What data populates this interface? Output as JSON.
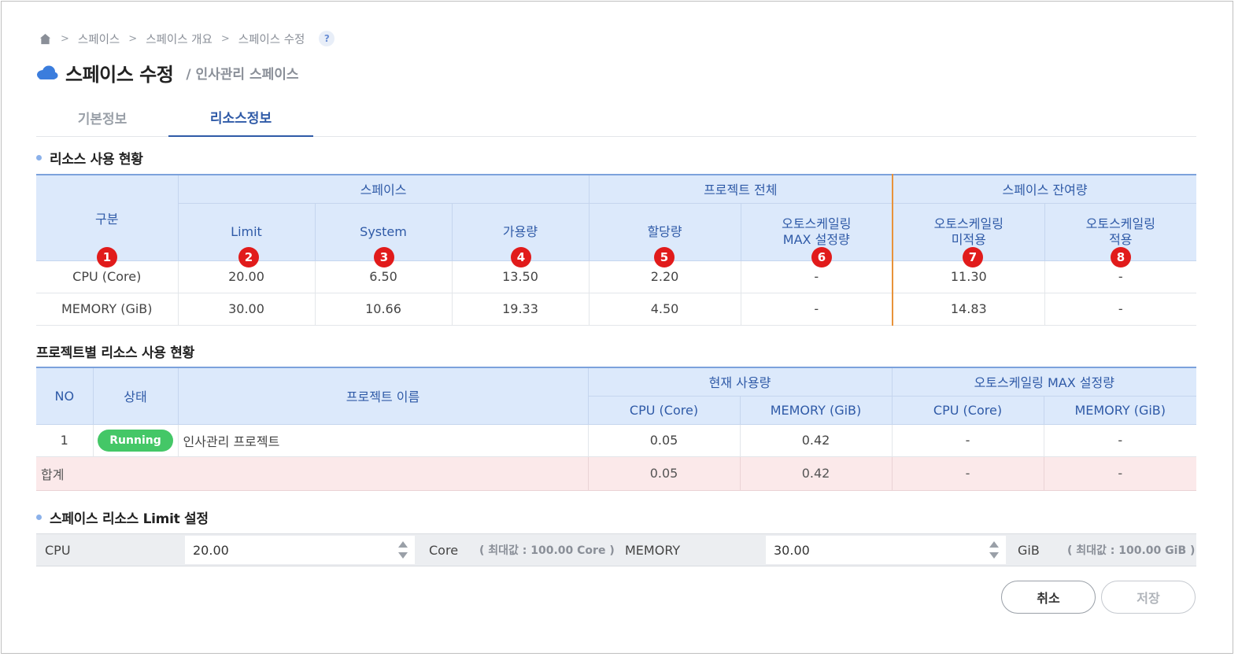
{
  "breadcrumb": {
    "items": [
      "스페이스",
      "스페이스 개요",
      "스페이스 수정"
    ],
    "help": "?"
  },
  "header": {
    "title": "스페이스 수정",
    "subtitle": "/ 인사관리 스페이스"
  },
  "tabs": [
    {
      "label": "기본정보",
      "active": false
    },
    {
      "label": "리소스정보",
      "active": true
    }
  ],
  "resource_usage": {
    "title": "리소스 사용 현황",
    "group_headers": {
      "category": "구분",
      "space": "스페이스",
      "project_total": "프로젝트 전체",
      "space_remaining": "스페이스 잔여량"
    },
    "columns": {
      "limit": "Limit",
      "system": "System",
      "available": "가용량",
      "allocated": "할당량",
      "autoscale_max_1": "오토스케일링",
      "autoscale_max_2": "MAX 설정량",
      "not_applied_1": "오토스케일링",
      "not_applied_2": "미적용",
      "applied_1": "오토스케일링",
      "applied_2": "적용"
    },
    "markers": [
      "1",
      "2",
      "3",
      "4",
      "5",
      "6",
      "7",
      "8"
    ],
    "rows": [
      {
        "label": "CPU (Core)",
        "limit": "20.00",
        "system": "6.50",
        "available": "13.50",
        "allocated": "2.20",
        "autoscale_max": "-",
        "not_applied": "11.30",
        "applied": "-"
      },
      {
        "label": "MEMORY (GiB)",
        "limit": "30.00",
        "system": "10.66",
        "available": "19.33",
        "allocated": "4.50",
        "autoscale_max": "-",
        "not_applied": "14.83",
        "applied": "-"
      }
    ]
  },
  "project_usage": {
    "title": "프로젝트별 리소스 사용 현황",
    "headers": {
      "no": "NO",
      "status": "상태",
      "name": "프로젝트 이름",
      "current": "현재 사용량",
      "autoscale_max": "오토스케일링 MAX 설정량",
      "cpu": "CPU (Core)",
      "memory": "MEMORY (GiB)"
    },
    "rows": [
      {
        "no": "1",
        "status": "Running",
        "name": "인사관리 프로젝트",
        "cur_cpu": "0.05",
        "cur_mem": "0.42",
        "max_cpu": "-",
        "max_mem": "-"
      }
    ],
    "total": {
      "label": "합계",
      "cur_cpu": "0.05",
      "cur_mem": "0.42",
      "max_cpu": "-",
      "max_mem": "-"
    }
  },
  "limit_setting": {
    "title": "스페이스 리소스 Limit 설정",
    "cpu_label": "CPU",
    "cpu_value": "20.00",
    "cpu_unit": "Core",
    "cpu_max": "( 최대값 :  100.00 Core )",
    "mem_label": "MEMORY",
    "mem_value": "30.00",
    "mem_unit": "GiB",
    "mem_max": "( 최대값 :  100.00 GiB )"
  },
  "actions": {
    "cancel": "취소",
    "save": "저장"
  },
  "colors": {
    "accent": "#2f5aa7",
    "header_bg": "#dce9fb",
    "badge": "#e11b1b",
    "running": "#44c767",
    "total_bg": "#fbe9ea",
    "divider": "#e8923a"
  }
}
